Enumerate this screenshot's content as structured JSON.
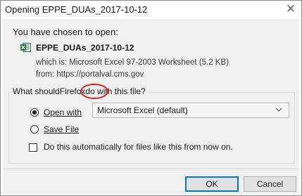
{
  "window": {
    "title": "Opening EPPE_DUAs_2017-10-12",
    "close_glyph": "✕"
  },
  "intro": "You have chosen to open:",
  "file": {
    "icon": "excel-file-icon",
    "name": "EPPE_DUAs_2017-10-12",
    "which_is": "which is: Microsoft Excel 97-2003 Worksheet (5.2 KB)",
    "from": "from: https://portalval.cms.gov"
  },
  "question": {
    "pre": "What should ",
    "brand": "Firefox",
    "post": " do with this file?"
  },
  "annotation": {
    "circle_color": "#e02020"
  },
  "options": {
    "open_with_label": "Open with",
    "open_with_selected": true,
    "app_select_value": "Microsoft Excel (default)",
    "save_file_label": "Save File",
    "save_file_selected": false,
    "auto_label": "Do this automatically for files like this from now on.",
    "auto_checked": false
  },
  "buttons": {
    "ok_label": "OK",
    "cancel_label": "Cancel"
  },
  "colors": {
    "accent": "#0078d7",
    "excel_green": "#1e7145"
  }
}
